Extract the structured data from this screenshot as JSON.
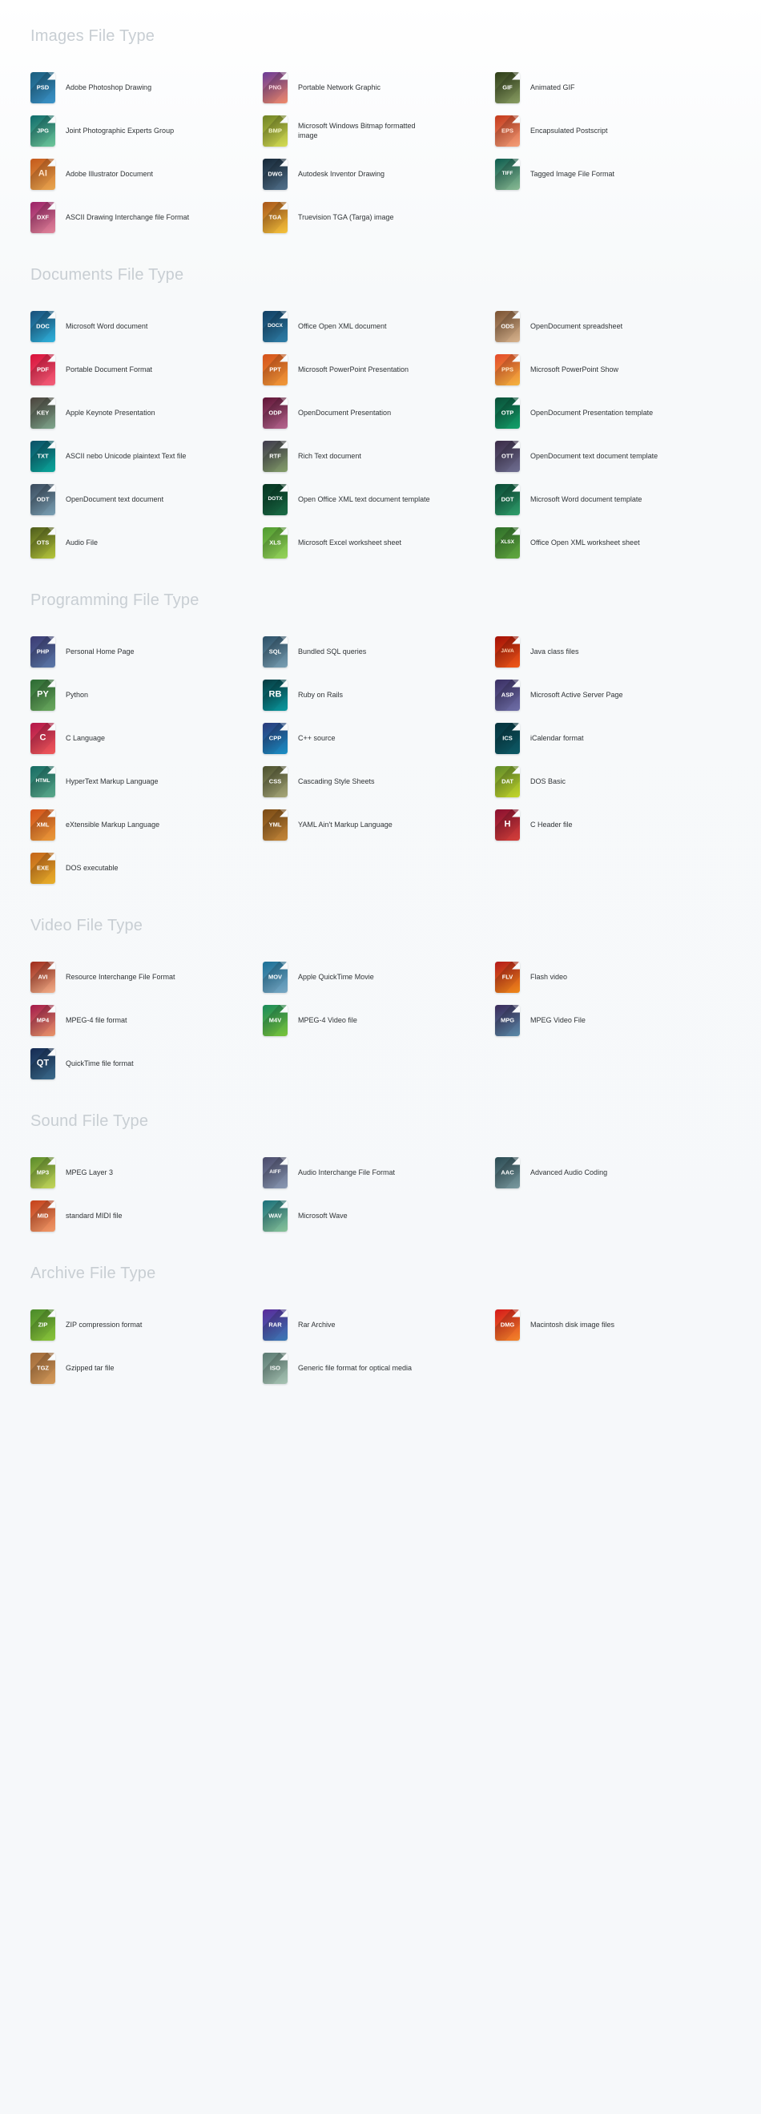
{
  "page": {
    "background": "#f7f9fa",
    "title_color": "#c8ced3",
    "desc_color": "#2f3336"
  },
  "sections": [
    {
      "id": "images",
      "title": "Images File Type",
      "items": [
        {
          "ext": "PSD",
          "desc": "Adobe Photoshop Drawing",
          "c1": "#1b5e7e",
          "c2": "#3b93c9",
          "tc": "#ffffff"
        },
        {
          "ext": "PNG",
          "desc": "Portable Network Graphic",
          "c1": "#6a3b96",
          "c2": "#f08a6a",
          "tc": "#fbd9e2"
        },
        {
          "ext": "GIF",
          "desc": "Animated GIF",
          "c1": "#2e3d18",
          "c2": "#8a9e63",
          "tc": "#ffffff"
        },
        {
          "ext": "JPG",
          "desc": "Joint Photographic Experts Group",
          "c1": "#0e6b6b",
          "c2": "#6fc79a",
          "tc": "#ffffff"
        },
        {
          "ext": "BMP",
          "desc": "Microsoft Windows Bitmap formatted image",
          "c1": "#6f8225",
          "c2": "#d6dd54",
          "tc": "#f4f6c9"
        },
        {
          "ext": "EPS",
          "desc": "Encapsulated Postscript",
          "c1": "#c4391b",
          "c2": "#f3a07a",
          "tc": "#ffe3d6"
        },
        {
          "ext": "AI",
          "desc": "Adobe Illustrator Document",
          "c1": "#c4591b",
          "c2": "#e8a650",
          "tc": "#ffe3c9"
        },
        {
          "ext": "DWG",
          "desc": "Autodesk Inventor Drawing",
          "c1": "#152736",
          "c2": "#52718c",
          "tc": "#ffffff"
        },
        {
          "ext": "TIFF",
          "desc": "Tagged Image File Format",
          "c1": "#0d5c4e",
          "c2": "#8bbb94",
          "tc": "#ffffff"
        },
        {
          "ext": "DXF",
          "desc": "ASCII Drawing Interchange file Format",
          "c1": "#9b2267",
          "c2": "#e0869a",
          "tc": "#ffffff"
        },
        {
          "ext": "TGA",
          "desc": "Truevision TGA (Targa) image",
          "c1": "#a8561a",
          "c2": "#f5c33c",
          "tc": "#ffffff"
        }
      ]
    },
    {
      "id": "documents",
      "title": "Documents File Type",
      "items": [
        {
          "ext": "DOC",
          "desc": "Microsoft Word document",
          "c1": "#1a4f7a",
          "c2": "#2fb3dd",
          "tc": "#ffffff"
        },
        {
          "ext": "DOCX",
          "desc": "Office Open XML document",
          "c1": "#123f63",
          "c2": "#2f7fa8",
          "tc": "#ffffff"
        },
        {
          "ext": "ODS",
          "desc": "OpenDocument spreadsheet",
          "c1": "#7a5232",
          "c2": "#d8b48f",
          "tc": "#ffffff"
        },
        {
          "ext": "PDF",
          "desc": "Portable Document Format",
          "c1": "#d8113a",
          "c2": "#f2607a",
          "tc": "#ffffff"
        },
        {
          "ext": "PPT",
          "desc": "Microsoft PowerPoint Presentation",
          "c1": "#d4521a",
          "c2": "#f09a3a",
          "tc": "#ffffff"
        },
        {
          "ext": "PPS",
          "desc": "Microsoft PowerPoint Show",
          "c1": "#e34a2a",
          "c2": "#f3b43f",
          "tc": "#ffe9c9"
        },
        {
          "ext": "KEY",
          "desc": "Apple Keynote Presentation",
          "c1": "#4a423c",
          "c2": "#7ea68c",
          "tc": "#ffffff"
        },
        {
          "ext": "ODP",
          "desc": "OpenDocument Presentation",
          "c1": "#5f1435",
          "c2": "#b5668f",
          "tc": "#ffffff"
        },
        {
          "ext": "OTP",
          "desc": "OpenDocument Presentation template",
          "c1": "#0b4f38",
          "c2": "#12a06a",
          "tc": "#ffffff"
        },
        {
          "ext": "TXT",
          "desc": "ASCII nebo Unicode plaintext Text file",
          "c1": "#0d4f66",
          "c2": "#0aa79a",
          "tc": "#ffffff"
        },
        {
          "ext": "RTF",
          "desc": "Rich Text document",
          "c1": "#3e3a4c",
          "c2": "#85a06a",
          "tc": "#ffffff"
        },
        {
          "ext": "OTT",
          "desc": "OpenDocument text document template",
          "c1": "#3a2b46",
          "c2": "#6f6f92",
          "tc": "#ffffff"
        },
        {
          "ext": "ODT",
          "desc": "OpenDocument text document",
          "c1": "#3a4a5c",
          "c2": "#7aa0b4",
          "tc": "#ffffff"
        },
        {
          "ext": "DOTX",
          "desc": "Open Office XML text document template",
          "c1": "#04331f",
          "c2": "#1a6b46",
          "tc": "#ffffff"
        },
        {
          "ext": "DOT",
          "desc": "Microsoft Word document template",
          "c1": "#0a4a35",
          "c2": "#2f9e6b",
          "tc": "#ffffff"
        },
        {
          "ext": "OTS",
          "desc": "Audio File",
          "c1": "#4e5c1c",
          "c2": "#b5c63a",
          "tc": "#ffffff"
        },
        {
          "ext": "XLS",
          "desc": "Microsoft Excel worksheet sheet",
          "c1": "#4f9a30",
          "c2": "#96d35a",
          "tc": "#ffffff"
        },
        {
          "ext": "XLSX",
          "desc": "Office Open XML worksheet sheet",
          "c1": "#2f6f2a",
          "c2": "#62a83f",
          "tc": "#ffffff"
        }
      ]
    },
    {
      "id": "programming",
      "title": "Programming File Type",
      "items": [
        {
          "ext": "PHP",
          "desc": "Personal Home Page",
          "c1": "#3b3a72",
          "c2": "#5a78a8",
          "tc": "#ffffff"
        },
        {
          "ext": "SQL",
          "desc": "Bundled SQL queries",
          "c1": "#2b4f66",
          "c2": "#7aa0b4",
          "tc": "#ffffff"
        },
        {
          "ext": "JAVA",
          "desc": "Java class files",
          "c1": "#a31006",
          "c2": "#ef5a1a",
          "tc": "#ffd9b5"
        },
        {
          "ext": "PY",
          "desc": "Python",
          "c1": "#2c6a33",
          "c2": "#6aa85e",
          "tc": "#ffffff"
        },
        {
          "ext": "RB",
          "desc": "Ruby on Rails",
          "c1": "#063a40",
          "c2": "#0a9aa0",
          "tc": "#ffffff"
        },
        {
          "ext": "ASP",
          "desc": "Microsoft Active Server Page",
          "c1": "#3a2f63",
          "c2": "#6f6fa8",
          "tc": "#ffffff"
        },
        {
          "ext": "C",
          "desc": "C Language",
          "c1": "#b3174a",
          "c2": "#ef5a5a",
          "tc": "#ffffff"
        },
        {
          "ext": "CPP",
          "desc": "C++ source",
          "c1": "#2a3a7a",
          "c2": "#1a8ec4",
          "tc": "#ffffff"
        },
        {
          "ext": "ICS",
          "desc": "iCalendar format",
          "c1": "#06333d",
          "c2": "#0d5a66",
          "tc": "#ffffff"
        },
        {
          "ext": "HTML",
          "desc": "HyperText Markup Language",
          "c1": "#166b63",
          "c2": "#5aa88a",
          "tc": "#ffffff"
        },
        {
          "ext": "CSS",
          "desc": "Cascading Style Sheets",
          "c1": "#4a4f2c",
          "c2": "#a8a87a",
          "tc": "#ffffff"
        },
        {
          "ext": "DAT",
          "desc": "DOS Basic",
          "c1": "#5f8a2a",
          "c2": "#c4d62a",
          "tc": "#ffffff"
        },
        {
          "ext": "XML",
          "desc": "eXtensible Markup Language",
          "c1": "#d4521a",
          "c2": "#e89a3a",
          "tc": "#ffffff"
        },
        {
          "ext": "YML",
          "desc": "YAML Ain't Markup Language",
          "c1": "#7a4a14",
          "c2": "#c4873a",
          "tc": "#ffffff"
        },
        {
          "ext": "H",
          "desc": "C Header file",
          "c1": "#8a1030",
          "c2": "#d4403a",
          "tc": "#ffffff"
        },
        {
          "ext": "EXE",
          "desc": "DOS executable",
          "c1": "#c4651a",
          "c2": "#e8b02a",
          "tc": "#ffffff"
        }
      ]
    },
    {
      "id": "video",
      "title": "Video File Type",
      "items": [
        {
          "ext": "AVI",
          "desc": "Resource Interchange File Format",
          "c1": "#9e2a1a",
          "c2": "#f2b08a",
          "tc": "#ffffff"
        },
        {
          "ext": "MOV",
          "desc": "Apple QuickTime Movie",
          "c1": "#1a6f96",
          "c2": "#7aa8c4",
          "tc": "#ffffff"
        },
        {
          "ext": "FLV",
          "desc": "Flash video",
          "c1": "#b31a1a",
          "c2": "#ef8a1a",
          "tc": "#ffffff"
        },
        {
          "ext": "MP4",
          "desc": "MPEG-4 file format",
          "c1": "#a31a4a",
          "c2": "#e8966a",
          "tc": "#ffffff"
        },
        {
          "ext": "M4V",
          "desc": "MPEG-4 Video file",
          "c1": "#1a8a5a",
          "c2": "#7ac43a",
          "tc": "#ffffff"
        },
        {
          "ext": "MPG",
          "desc": "MPEG Video File",
          "c1": "#3a2a5a",
          "c2": "#5a8aa8",
          "tc": "#ffffff"
        },
        {
          "ext": "QT",
          "desc": "QuickTime file format",
          "c1": "#152a52",
          "c2": "#3a6a8a",
          "tc": "#ffffff"
        }
      ]
    },
    {
      "id": "sound",
      "title": "Sound File Type",
      "items": [
        {
          "ext": "MP3",
          "desc": "MPEG Layer 3",
          "c1": "#5a8a2a",
          "c2": "#c4d65a",
          "tc": "#ffffff"
        },
        {
          "ext": "AIFF",
          "desc": "Audio Interchange File Format",
          "c1": "#4a4a6a",
          "c2": "#8a9ab4",
          "tc": "#ffffff"
        },
        {
          "ext": "AAC",
          "desc": "Advanced Audio Coding",
          "c1": "#2a4a52",
          "c2": "#7a9aa0",
          "tc": "#ffffff"
        },
        {
          "ext": "MID",
          "desc": "standard MIDI file",
          "c1": "#c4401a",
          "c2": "#ef9a6a",
          "tc": "#ffffff"
        },
        {
          "ext": "WAV",
          "desc": "Microsoft Wave",
          "c1": "#1a6f7a",
          "c2": "#8ac49a",
          "tc": "#ffffff"
        }
      ]
    },
    {
      "id": "archive",
      "title": "Archive File Type",
      "items": [
        {
          "ext": "ZIP",
          "desc": "ZIP compression format",
          "c1": "#4a8a2a",
          "c2": "#8ac43a",
          "tc": "#ffffff"
        },
        {
          "ext": "RAR",
          "desc": "Rar Archive",
          "c1": "#5a2a9a",
          "c2": "#3a7ab4",
          "tc": "#ffffff"
        },
        {
          "ext": "DMG",
          "desc": "Macintosh disk image files",
          "c1": "#d41a1a",
          "c2": "#f2862a",
          "tc": "#ffffff"
        },
        {
          "ext": "TGZ",
          "desc": "Gzipped tar file",
          "c1": "#a06a3a",
          "c2": "#d49a5a",
          "tc": "#ffffff"
        },
        {
          "ext": "ISO",
          "desc": "Generic file format for optical media",
          "c1": "#5a7a72",
          "c2": "#a8c4b4",
          "tc": "#ffffff"
        }
      ]
    }
  ]
}
